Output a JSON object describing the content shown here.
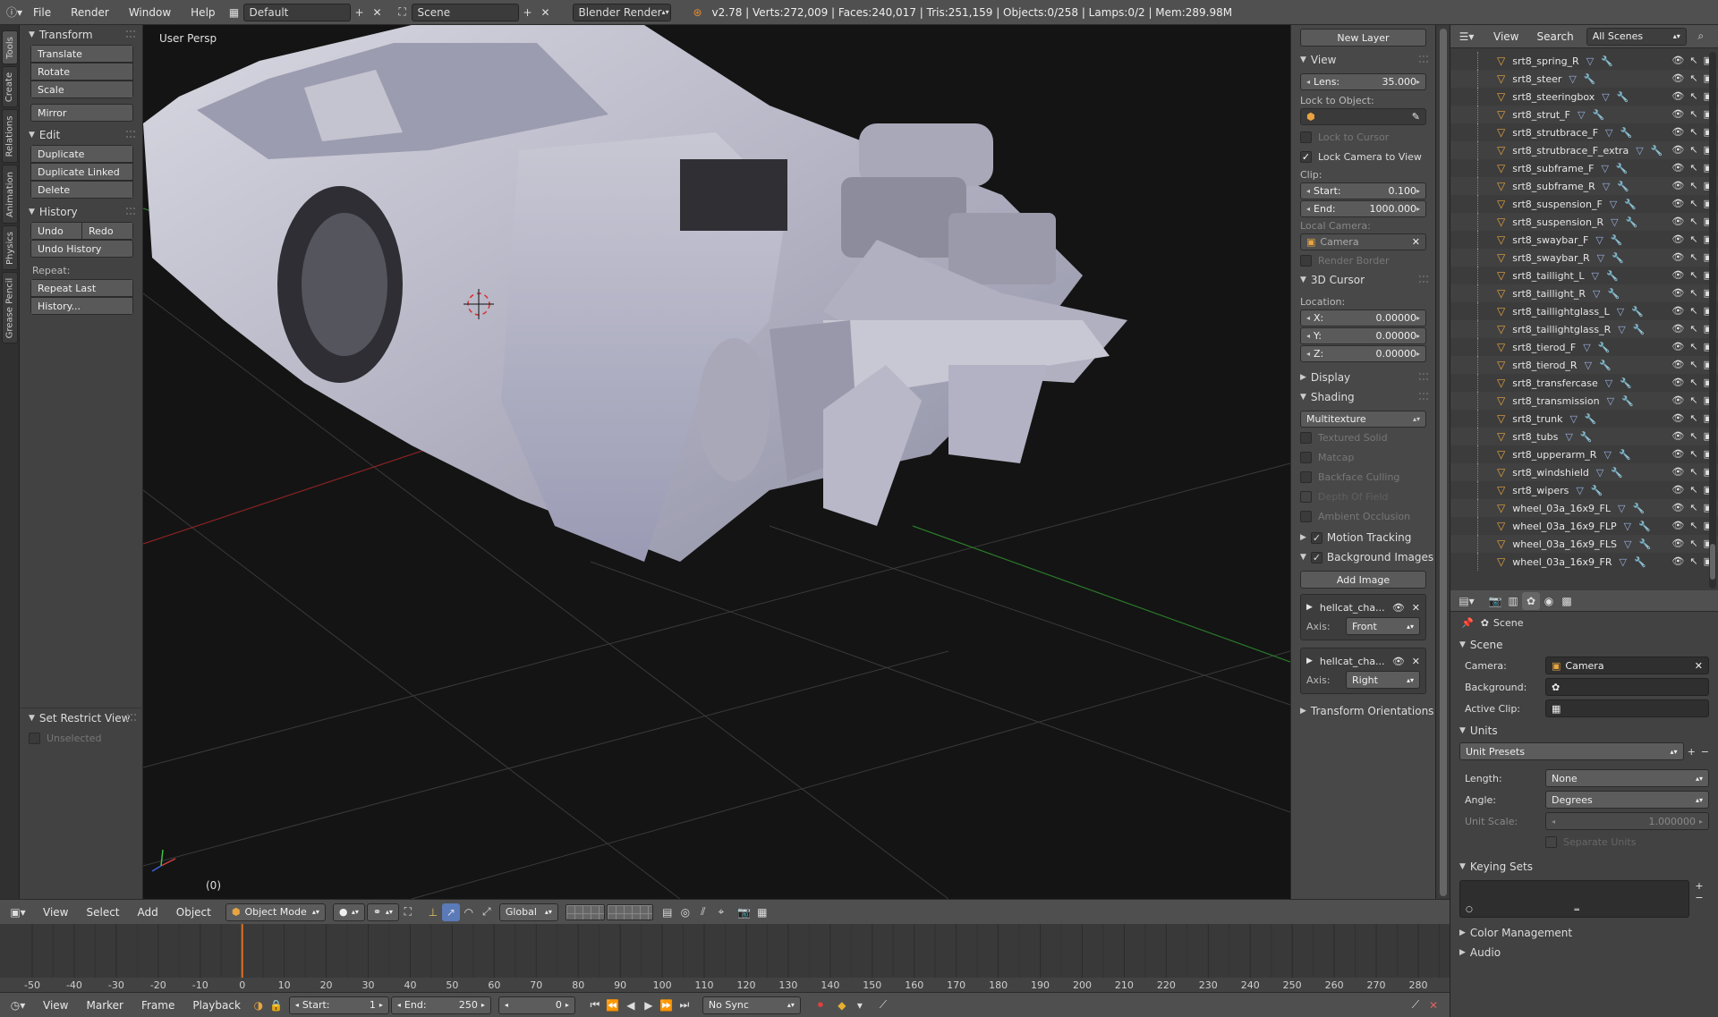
{
  "topbar": {
    "menus": [
      "File",
      "Render",
      "Window",
      "Help"
    ],
    "layout": "Default",
    "scene": "Scene",
    "engine": "Blender Render",
    "info": "v2.78 | Verts:272,009 | Faces:240,017 | Tris:251,159 | Objects:0/258 | Lamps:0/2 | Mem:289.98M"
  },
  "tabs": [
    "Tools",
    "Create",
    "Relations",
    "Animation",
    "Physics",
    "Grease Pencil"
  ],
  "toolshelf": {
    "transform": "Transform",
    "translate": "Translate",
    "rotate": "Rotate",
    "scale": "Scale",
    "mirror": "Mirror",
    "edit": "Edit",
    "duplicate": "Duplicate",
    "duplicate_linked": "Duplicate Linked",
    "delete": "Delete",
    "history": "History",
    "undo": "Undo",
    "redo": "Redo",
    "undo_history": "Undo History",
    "repeat": "Repeat:",
    "repeat_last": "Repeat Last",
    "history_btn": "History...",
    "restrict_view": "Set Restrict View",
    "unselected": "Unselected"
  },
  "viewport": {
    "label": "User Persp",
    "frame": "(0)"
  },
  "npanel": {
    "new_layer": "New Layer",
    "view": "View",
    "lens_label": "Lens:",
    "lens_value": "35.000",
    "lock_to_object": "Lock to Object:",
    "lock_to_cursor": "Lock to Cursor",
    "lock_camera": "Lock Camera to View",
    "clip": "Clip:",
    "start_label": "Start:",
    "start_value": "0.100",
    "end_label": "End:",
    "end_value": "1000.000",
    "local_camera": "Local Camera:",
    "camera": "Camera",
    "render_border": "Render Border",
    "cursor": "3D Cursor",
    "location": "Location:",
    "x_label": "X:",
    "x_value": "0.00000",
    "y_label": "Y:",
    "y_value": "0.00000",
    "z_label": "Z:",
    "z_value": "0.00000",
    "display": "Display",
    "shading": "Shading",
    "shading_mode": "Multitexture",
    "textured_solid": "Textured Solid",
    "matcap": "Matcap",
    "backface": "Backface Culling",
    "dof": "Depth Of Field",
    "ao": "Ambient Occlusion",
    "motion_tracking": "Motion Tracking",
    "background_images": "Background Images",
    "add_image": "Add Image",
    "bg1_name": "hellcat_cha...",
    "bg1_axis_label": "Axis:",
    "bg1_axis": "Front",
    "bg2_name": "hellcat_cha...",
    "bg2_axis_label": "Axis:",
    "bg2_axis": "Right",
    "transform_orient": "Transform Orientations"
  },
  "outliner": {
    "view": "View",
    "search": "Search",
    "filter": "All Scenes",
    "items": [
      "srt8_spring_R",
      "srt8_steer",
      "srt8_steeringbox",
      "srt8_strut_F",
      "srt8_strutbrace_F",
      "srt8_strutbrace_F_extra",
      "srt8_subframe_F",
      "srt8_subframe_R",
      "srt8_suspension_F",
      "srt8_suspension_R",
      "srt8_swaybar_F",
      "srt8_swaybar_R",
      "srt8_taillight_L",
      "srt8_taillight_R",
      "srt8_taillightglass_L",
      "srt8_taillightglass_R",
      "srt8_tierod_F",
      "srt8_tierod_R",
      "srt8_transfercase",
      "srt8_transmission",
      "srt8_trunk",
      "srt8_tubs",
      "srt8_upperarm_R",
      "srt8_windshield",
      "srt8_wipers",
      "wheel_03a_16x9_FL",
      "wheel_03a_16x9_FLP",
      "wheel_03a_16x9_FLS",
      "wheel_03a_16x9_FR"
    ]
  },
  "props": {
    "context": "Scene",
    "scene_panel": "Scene",
    "camera_label": "Camera:",
    "camera_value": "Camera",
    "background_label": "Background:",
    "active_clip_label": "Active Clip:",
    "units": "Units",
    "unit_presets": "Unit Presets",
    "length_label": "Length:",
    "length_value": "None",
    "angle_label": "Angle:",
    "angle_value": "Degrees",
    "unit_scale_label": "Unit Scale:",
    "unit_scale_value": "1.000000",
    "separate_units": "Separate Units",
    "keying_sets": "Keying Sets",
    "color_management": "Color Management",
    "audio": "Audio"
  },
  "viewport_header": {
    "menus": [
      "View",
      "Select",
      "Add",
      "Object"
    ],
    "mode": "Object Mode",
    "orientation": "Global"
  },
  "timeline": {
    "ticks": [
      "-50",
      "-40",
      "-30",
      "-20",
      "-10",
      "0",
      "10",
      "20",
      "30",
      "40",
      "50",
      "60",
      "70",
      "80",
      "90",
      "100",
      "110",
      "120",
      "130",
      "140",
      "150",
      "160",
      "170",
      "180",
      "190",
      "200",
      "210",
      "220",
      "230",
      "240",
      "250",
      "260",
      "270",
      "280"
    ],
    "current_frame_value": 0
  },
  "timeline_header": {
    "menus": [
      "View",
      "Marker",
      "Frame",
      "Playback"
    ],
    "start_label": "Start:",
    "start_value": "1",
    "end_label": "End:",
    "end_value": "250",
    "current": "0",
    "sync": "No Sync"
  }
}
